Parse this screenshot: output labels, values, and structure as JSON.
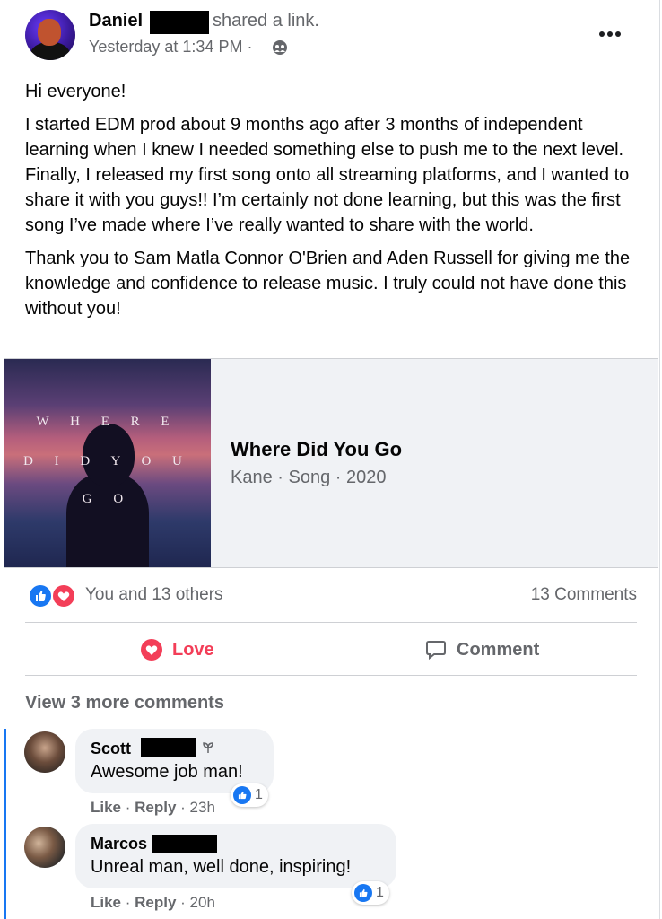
{
  "post": {
    "author_name": "Daniel",
    "shared_text": "shared a link.",
    "timestamp": "Yesterday at 1:34 PM ·",
    "paragraphs": [
      "Hi everyone!",
      "I started EDM prod about 9 months ago after 3 months of independent learning when I knew I needed something else to push me to the next level. Finally, I released my first song onto all streaming platforms, and I wanted to share it with you guys!! I’m certainly not done learning, but this was the first song I’ve made where I’ve really wanted to share with the world.",
      "Thank you to Sam Matla Connor O'Brien and Aden Russell for giving me the knowledge and confidence to release music. I truly could not have done this without you!"
    ]
  },
  "link": {
    "cover_lines": [
      "W H E R E",
      "D I D   Y O U",
      "G O"
    ],
    "title": "Where Did You Go",
    "subtitle": "Kane · Song · 2020"
  },
  "reactions": {
    "summary": "You and 13 others",
    "comment_count": "13 Comments"
  },
  "actions": {
    "love_label": "Love",
    "comment_label": "Comment"
  },
  "comments_section": {
    "view_more": "View 3 more comments",
    "comments": [
      {
        "name": "Scott",
        "text": "Awesome job man!",
        "like": "Like",
        "reply": "Reply",
        "time": "23h",
        "reaction_count": "1"
      },
      {
        "name": "Marcos",
        "text": "Unreal man, well done, inspiring!",
        "like": "Like",
        "reply": "Reply",
        "time": "20h",
        "reaction_count": "1"
      }
    ]
  },
  "colors": {
    "like_blue": "#1877f2",
    "love_red": "#f33e58",
    "secondary_text": "#65676b"
  }
}
